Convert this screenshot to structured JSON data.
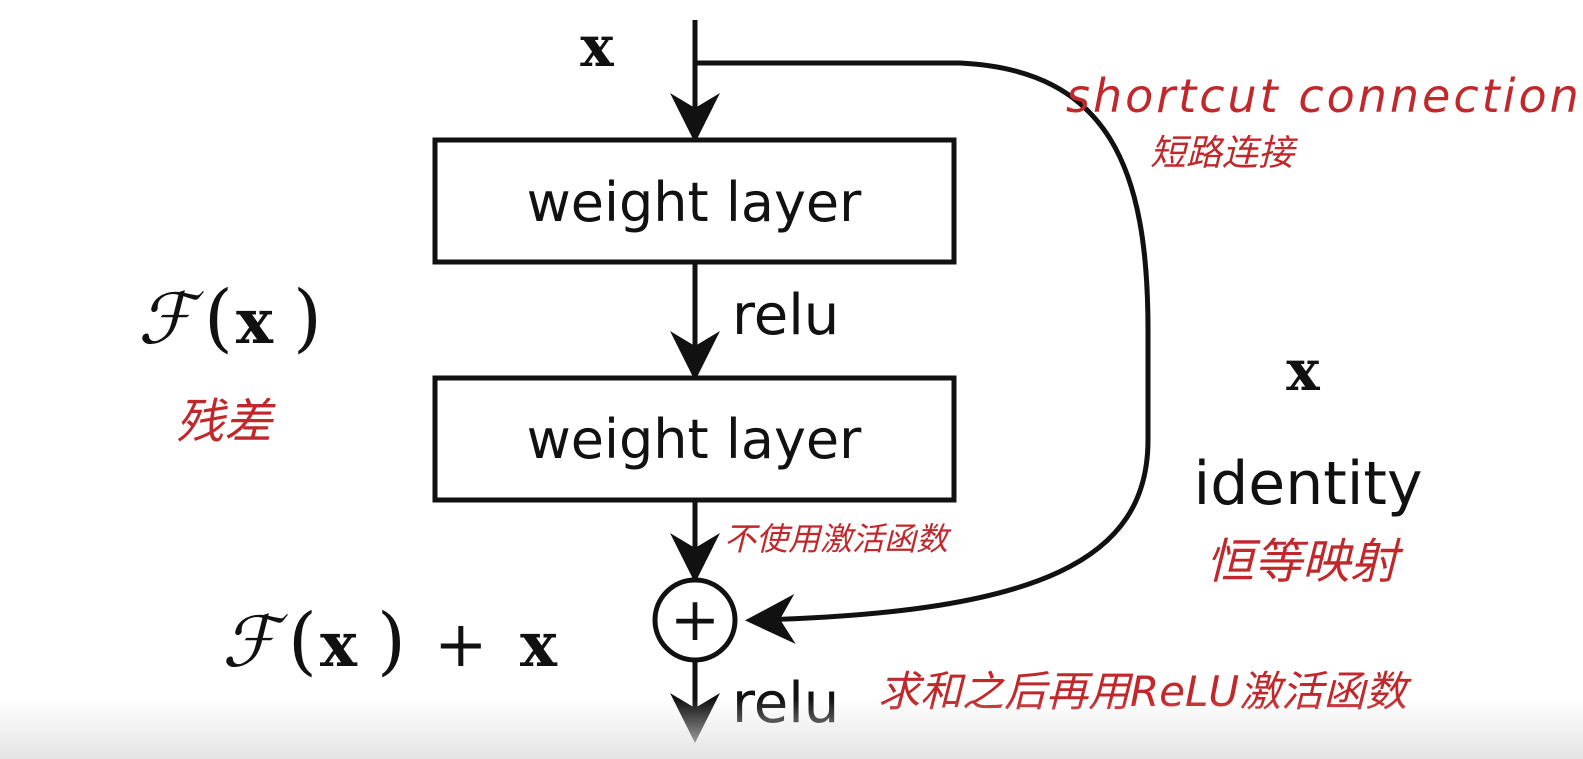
{
  "input_label": "x",
  "blocks": [
    {
      "label": "weight layer"
    },
    {
      "label": "weight layer"
    }
  ],
  "relu_mid": "relu",
  "relu_out": "relu",
  "identity": {
    "symbol": "x",
    "label": "identity"
  },
  "residual": {
    "F": "ℱ",
    "x": "x",
    "open": "(",
    "close": ")",
    "plus": "+"
  },
  "sum_symbol": "+",
  "notes": {
    "shortcut_en": "shortcut connection",
    "shortcut_zh": "短路连接",
    "residual_zh": "残差",
    "no_activation": "不使用激活函数",
    "identity_zh": "恒等映射",
    "sum_relu": "求和之后再用ReLU激活函数"
  },
  "colors": {
    "ink": "#111111",
    "annotation": "#c0282b"
  }
}
